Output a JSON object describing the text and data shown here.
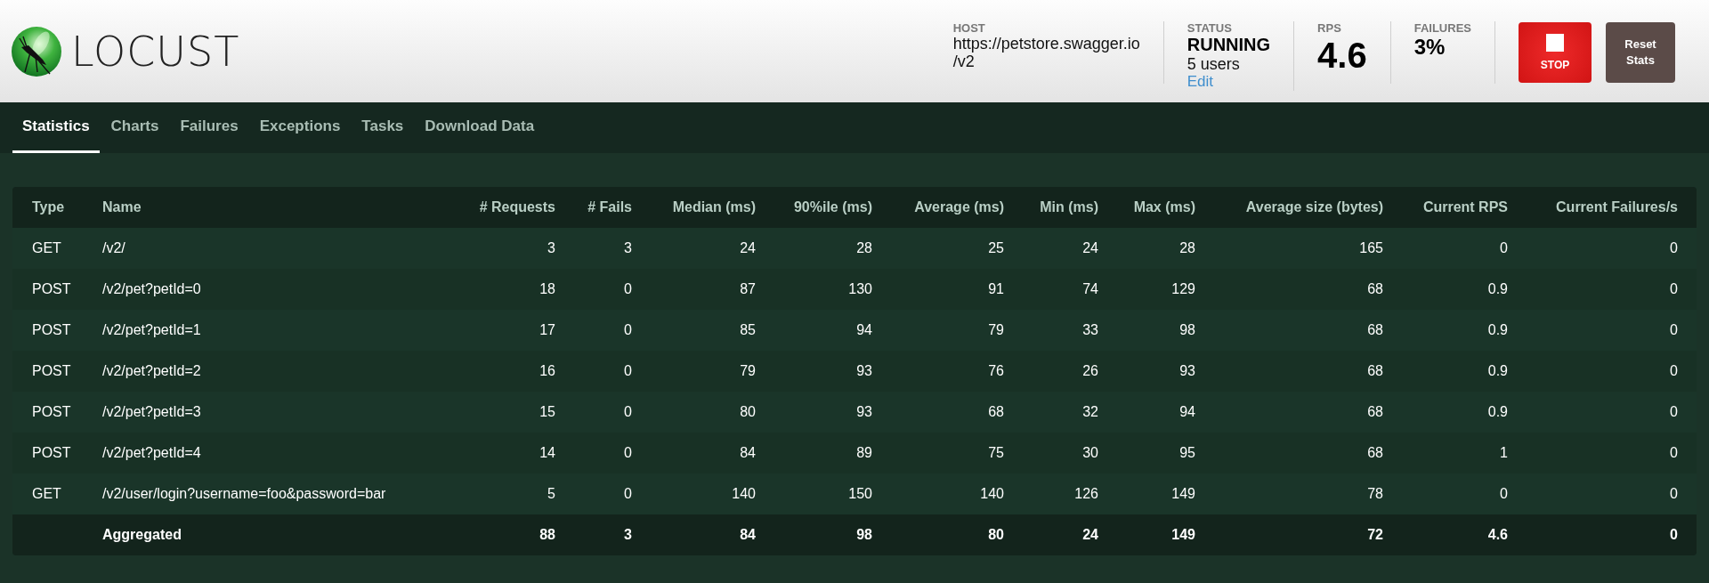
{
  "header": {
    "logo_text": "LOCUST",
    "host": {
      "label": "HOST",
      "value_lines": [
        "https://petstore.swagger.io",
        "/v2"
      ]
    },
    "status": {
      "label": "STATUS",
      "state": "RUNNING",
      "users": "5 users",
      "edit": "Edit"
    },
    "rps": {
      "label": "RPS",
      "value": "4.6"
    },
    "failures": {
      "label": "FAILURES",
      "value": "3%"
    },
    "buttons": [
      {
        "kind": "stop",
        "label": "STOP"
      },
      {
        "kind": "reset",
        "label": "Reset Stats"
      }
    ]
  },
  "tabs": [
    {
      "label": "Statistics",
      "selected": true
    },
    {
      "label": "Charts",
      "selected": false
    },
    {
      "label": "Failures",
      "selected": false
    },
    {
      "label": "Exceptions",
      "selected": false
    },
    {
      "label": "Tasks",
      "selected": false
    },
    {
      "label": "Download Data",
      "selected": false
    }
  ],
  "table": {
    "columns": [
      "Type",
      "Name",
      "# Requests",
      "# Fails",
      "Median (ms)",
      "90%ile (ms)",
      "Average (ms)",
      "Min (ms)",
      "Max (ms)",
      "Average size (bytes)",
      "Current RPS",
      "Current Failures/s"
    ],
    "rows": [
      {
        "kind": "request",
        "cells": [
          "GET",
          "/v2/",
          "3",
          "3",
          "24",
          "28",
          "25",
          "24",
          "28",
          "165",
          "0",
          "0"
        ]
      },
      {
        "kind": "request",
        "cells": [
          "POST",
          "/v2/pet?petId=0",
          "18",
          "0",
          "87",
          "130",
          "91",
          "74",
          "129",
          "68",
          "0.9",
          "0"
        ]
      },
      {
        "kind": "request",
        "cells": [
          "POST",
          "/v2/pet?petId=1",
          "17",
          "0",
          "85",
          "94",
          "79",
          "33",
          "98",
          "68",
          "0.9",
          "0"
        ]
      },
      {
        "kind": "request",
        "cells": [
          "POST",
          "/v2/pet?petId=2",
          "16",
          "0",
          "79",
          "93",
          "76",
          "26",
          "93",
          "68",
          "0.9",
          "0"
        ]
      },
      {
        "kind": "request",
        "cells": [
          "POST",
          "/v2/pet?petId=3",
          "15",
          "0",
          "80",
          "93",
          "68",
          "32",
          "94",
          "68",
          "0.9",
          "0"
        ]
      },
      {
        "kind": "request",
        "cells": [
          "POST",
          "/v2/pet?petId=4",
          "14",
          "0",
          "84",
          "89",
          "75",
          "30",
          "95",
          "68",
          "1",
          "0"
        ]
      },
      {
        "kind": "request",
        "cells": [
          "GET",
          "/v2/user/login?username=foo&password=bar",
          "5",
          "0",
          "140",
          "150",
          "140",
          "126",
          "149",
          "78",
          "0",
          "0"
        ]
      },
      {
        "kind": "aggregate",
        "cells": [
          "",
          "Aggregated",
          "88",
          "3",
          "84",
          "98",
          "80",
          "24",
          "149",
          "72",
          "4.6",
          "0"
        ]
      }
    ]
  }
}
